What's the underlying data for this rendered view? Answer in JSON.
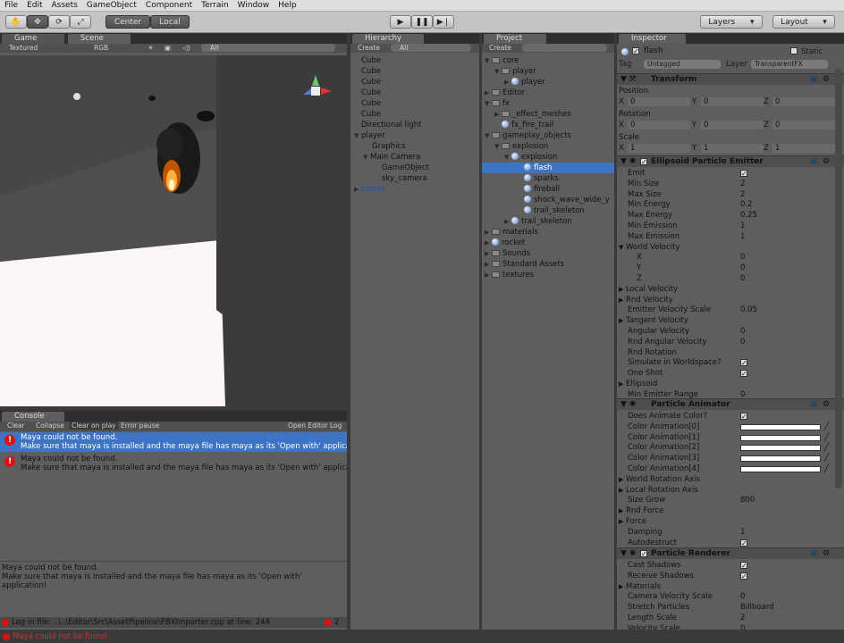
{
  "menu": [
    "File",
    "Edit",
    "Assets",
    "GameObject",
    "Component",
    "Terrain",
    "Window",
    "Help"
  ],
  "toolbar": {
    "center": "Center",
    "local": "Local",
    "layers": "Layers",
    "layout": "Layout"
  },
  "scene": {
    "tab_game": "Game",
    "tab_scene": "Scene",
    "mode": "Textured",
    "rgb": "RGB",
    "search": "All"
  },
  "console": {
    "tab": "Console",
    "buttons": [
      "Clear",
      "Collapse",
      "Clear on play",
      "Error pause"
    ],
    "open_log": "Open Editor Log",
    "messages": [
      {
        "line1": "Maya could not be found.",
        "line2": "Make sure that maya is installed and the maya file has maya as its 'Open with' applica"
      },
      {
        "line1": "Maya could not be found.",
        "line2": "Make sure that maya is installed and the maya file has maya as its 'Open with' applica"
      }
    ],
    "detail1": "Maya could not be found.",
    "detail2": "Make sure that maya is installed and the maya file has maya as its 'Open with' application!",
    "logfile": "Log in file: ..\\..\\Editor\\Src\\AssetPipeline\\FBXImporter.cpp at line: 244",
    "count": "2",
    "status": "Maya could not be found."
  },
  "hierarchy": {
    "tab": "Hierarchy",
    "create": "Create",
    "search": "All",
    "items": [
      "Cube",
      "Cube",
      "Cube",
      "Cube",
      "Cube",
      "Cube",
      "Directional light",
      "player",
      "Graphics",
      "Main Camera",
      "GameObject",
      "sky_camera",
      "rocket"
    ]
  },
  "project": {
    "tab": "Project",
    "create": "Create",
    "items": [
      "core",
      "player",
      "player",
      "Editor",
      "fx",
      "_effect_meshes",
      "fx_fire_trail",
      "gameplay_objects",
      "explosion",
      "explosion",
      "flash",
      "sparks",
      "fireball",
      "shock_wave_wide_y",
      "trail_skeleton",
      "trail_skeleton",
      "materials",
      "rocket",
      "Sounds",
      "Standard Assets",
      "textures"
    ]
  },
  "inspector": {
    "tab": "Inspector",
    "name": "flash",
    "static": "Static",
    "tag_label": "Tag",
    "tag": "Untagged",
    "layer_label": "Layer",
    "layer": "TransparentFX",
    "transform": "Transform",
    "position": "Position",
    "rotation": "Rotation",
    "scale": "Scale",
    "pos": [
      "0",
      "0",
      "0"
    ],
    "rot": [
      "0",
      "0",
      "0"
    ],
    "scl": [
      "1",
      "1",
      "1"
    ],
    "axes": [
      "X",
      "Y",
      "Z"
    ],
    "emitter": "Ellipsoid Particle Emitter",
    "emitter_rows": [
      [
        "Emit",
        ""
      ],
      [
        "Min Size",
        "2"
      ],
      [
        "Max Size",
        "2"
      ],
      [
        "Min Energy",
        "0.2"
      ],
      [
        "Max Energy",
        "0.25"
      ],
      [
        "Min Emission",
        "1"
      ],
      [
        "Max Emission",
        "1"
      ],
      [
        "World Velocity",
        ""
      ],
      [
        "X",
        "0"
      ],
      [
        "Y",
        "0"
      ],
      [
        "Z",
        "0"
      ],
      [
        "Local Velocity",
        ""
      ],
      [
        "Rnd Velocity",
        ""
      ],
      [
        "Emitter Velocity Scale",
        "0.05"
      ],
      [
        "Tangent Velocity",
        ""
      ],
      [
        "Angular Velocity",
        "0"
      ],
      [
        "Rnd Angular Velocity",
        "0"
      ],
      [
        "Rnd Rotation",
        ""
      ],
      [
        "Simulate in Worldspace?",
        ""
      ],
      [
        "One Shot",
        ""
      ],
      [
        "Ellipsoid",
        ""
      ],
      [
        "Min Emitter Range",
        "0"
      ]
    ],
    "animator": "Particle Animator",
    "animator_rows": [
      [
        "Does Animate Color?",
        ""
      ],
      [
        "Color Animation[0]",
        ""
      ],
      [
        "Color Animation[1]",
        ""
      ],
      [
        "Color Animation[2]",
        ""
      ],
      [
        "Color Animation[3]",
        ""
      ],
      [
        "Color Animation[4]",
        ""
      ],
      [
        "World Rotation Axis",
        ""
      ],
      [
        "Local Rotation Axis",
        ""
      ],
      [
        "Size Grow",
        "800"
      ],
      [
        "Rnd Force",
        ""
      ],
      [
        "Force",
        ""
      ],
      [
        "Damping",
        "1"
      ],
      [
        "Autodestruct",
        ""
      ]
    ],
    "renderer": "Particle Renderer",
    "renderer_rows": [
      [
        "Cast Shadows",
        ""
      ],
      [
        "Receive Shadows",
        ""
      ],
      [
        "Materials",
        ""
      ],
      [
        "Camera Velocity Scale",
        "0"
      ],
      [
        "Stretch Particles",
        "Billboard"
      ],
      [
        "Length Scale",
        "2"
      ],
      [
        "Velocity Scale",
        "0"
      ]
    ]
  }
}
